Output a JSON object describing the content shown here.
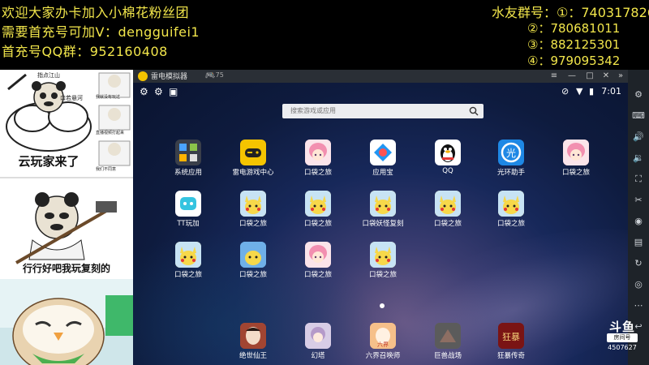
{
  "overlay": {
    "line1": "欢迎大家办卡加入小棉花粉丝团",
    "line2": "需要首充号可加V：dengguifei1",
    "line3": "首充号QQ群：952160408",
    "qq_title": "水友群号：①：740317826",
    "qq_group2": "②：780681011",
    "qq_group3": "③：882125301",
    "qq_group4": "④：979095342"
  },
  "memes": {
    "meme1_small_1": "指点江山",
    "meme1_small_2": "口若悬河",
    "meme1_caption": "云玩家来了",
    "meme1_side_1": "我就没有玩过",
    "meme1_side_2": "直播视频打起来",
    "meme1_side_3": "我们不同意",
    "meme2_caption": "行行好吧我玩复刻的"
  },
  "emulator": {
    "title": "雷电模拟器",
    "version": "3.75",
    "time": "7:01",
    "search_placeholder": "搜索游戏或应用"
  },
  "apps_row1": [
    {
      "label": "系统应用",
      "icon": "system-apps-folder",
      "color": "#3a3f4a"
    },
    {
      "label": "雷电游戏中心",
      "icon": "gamepad",
      "color": "#f5c400"
    },
    {
      "label": "口袋之旅",
      "icon": "anime-girl",
      "color": "#f4a6b8"
    },
    {
      "label": "应用宝",
      "icon": "app-store",
      "color": "#ffffff"
    },
    {
      "label": "QQ",
      "icon": "penguin",
      "color": "#ffffff"
    },
    {
      "label": "光环助手",
      "icon": "halo",
      "color": "#1e88e5"
    },
    {
      "label": "口袋之旅",
      "icon": "anime-girl",
      "color": "#f4a6b8"
    }
  ],
  "apps_row2": [
    {
      "label": "TT玩加",
      "icon": "tt",
      "color": "#ffffff"
    },
    {
      "label": "口袋之旅",
      "icon": "pikachu",
      "color": "#f2d24a"
    },
    {
      "label": "口袋之旅",
      "icon": "pikachu",
      "color": "#f2d24a"
    },
    {
      "label": "口袋妖怪复刻",
      "icon": "pikachu",
      "color": "#f2d24a"
    },
    {
      "label": "口袋之旅",
      "icon": "pikachu",
      "color": "#f2d24a"
    },
    {
      "label": "口袋之旅",
      "icon": "pikachu",
      "color": "#f2d24a"
    }
  ],
  "apps_row3": [
    {
      "label": "口袋之旅",
      "icon": "pikachu",
      "color": "#f2d24a"
    },
    {
      "label": "口袋之旅",
      "icon": "pikachu-blue",
      "color": "#6fb0e8"
    },
    {
      "label": "口袋之旅",
      "icon": "anime-girl",
      "color": "#f4a6b8"
    },
    {
      "label": "口袋之旅",
      "icon": "pikachu",
      "color": "#f2d24a"
    }
  ],
  "dock": [
    {
      "label": "绝世仙王",
      "icon": "xianwang",
      "color": "#b04a3a"
    },
    {
      "label": "幻塔",
      "icon": "tower",
      "color": "#c9b7d8"
    },
    {
      "label": "六界召唤师",
      "icon": "summoner",
      "color": "#e08a5a"
    },
    {
      "label": "巨兽战场",
      "icon": "beast",
      "color": "#6a6a6a"
    },
    {
      "label": "狂暴传奇",
      "icon": "legend",
      "color": "#8b1a1a"
    }
  ],
  "watermark": {
    "brand": "斗鱼",
    "room_label": "房间号",
    "room_id": "4507627"
  }
}
